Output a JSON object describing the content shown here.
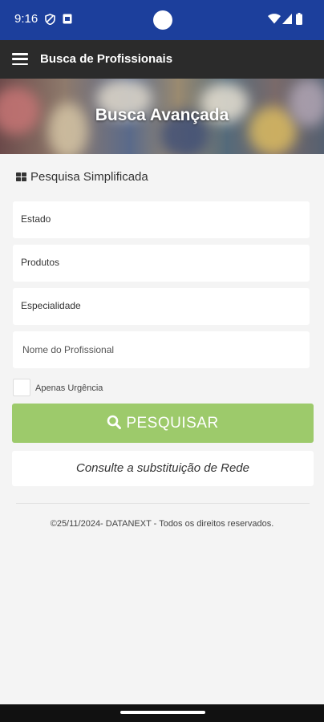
{
  "status_bar": {
    "time": "9:16"
  },
  "app_bar": {
    "title": "Busca de Profissionais"
  },
  "banner": {
    "title": "Busca Avançada"
  },
  "section": {
    "title": "Pesquisa Simplificada"
  },
  "form": {
    "estado_label": "Estado",
    "produtos_label": "Produtos",
    "especialidade_label": "Especialidade",
    "nome_placeholder": "Nome do Profissional",
    "urgencia_label": "Apenas Urgência"
  },
  "buttons": {
    "search_label": "PESQUISAR",
    "substitution_label": "Consulte a substituição de Rede"
  },
  "footer": {
    "text": "©25/11/2024- DATANEXT - Todos os direitos reservados."
  },
  "colors": {
    "status_bar": "#1c3f9c",
    "app_bar": "#2b2b2b",
    "search_button": "#9dca6b",
    "background": "#f4f4f4"
  }
}
